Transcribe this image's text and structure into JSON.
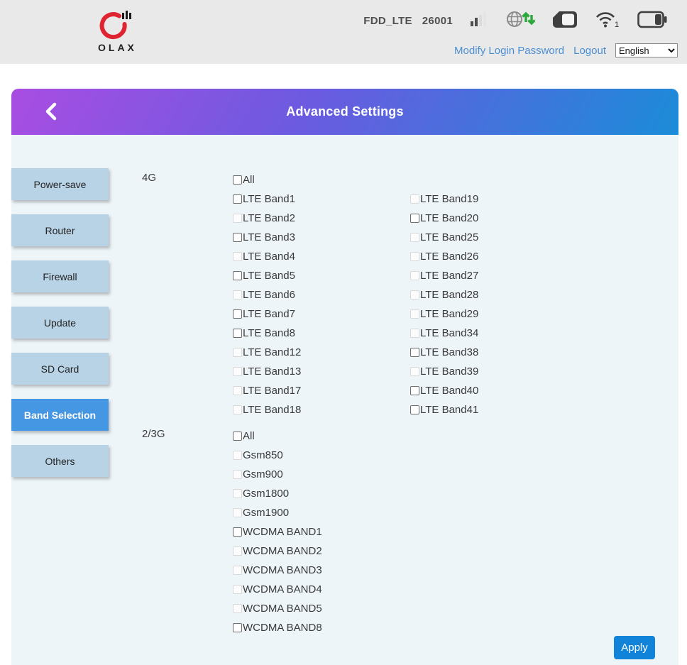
{
  "header": {
    "logo_text": "OLAX",
    "status": {
      "network_type": "FDD_LTE",
      "plmn": "26001",
      "wifi_clients": "1"
    },
    "links": {
      "modify_password": "Modify Login Password",
      "logout": "Logout"
    },
    "language": {
      "selected": "English",
      "options": [
        "English"
      ]
    }
  },
  "titlebar": {
    "title": "Advanced Settings"
  },
  "sidebar": {
    "items": [
      {
        "label": "Power-save",
        "active": false
      },
      {
        "label": "Router",
        "active": false
      },
      {
        "label": "Firewall",
        "active": false
      },
      {
        "label": "Update",
        "active": false
      },
      {
        "label": "SD Card",
        "active": false
      },
      {
        "label": "Band Selection",
        "active": true
      },
      {
        "label": "Others",
        "active": false
      }
    ]
  },
  "band_selection": {
    "section_4g_label": "4G",
    "section_23g_label": "2/3G",
    "bands_4g_col1": [
      {
        "label": "All",
        "enabled": true,
        "checked": false
      },
      {
        "label": "LTE Band1",
        "enabled": true,
        "checked": false
      },
      {
        "label": "LTE Band2",
        "enabled": false,
        "checked": false
      },
      {
        "label": "LTE Band3",
        "enabled": true,
        "checked": false
      },
      {
        "label": "LTE Band4",
        "enabled": false,
        "checked": false
      },
      {
        "label": "LTE Band5",
        "enabled": true,
        "checked": false
      },
      {
        "label": "LTE Band6",
        "enabled": false,
        "checked": false
      },
      {
        "label": "LTE Band7",
        "enabled": true,
        "checked": false
      },
      {
        "label": "LTE Band8",
        "enabled": true,
        "checked": false
      },
      {
        "label": "LTE Band12",
        "enabled": false,
        "checked": false
      },
      {
        "label": "LTE Band13",
        "enabled": false,
        "checked": false
      },
      {
        "label": "LTE Band17",
        "enabled": false,
        "checked": false
      },
      {
        "label": "LTE Band18",
        "enabled": false,
        "checked": false
      }
    ],
    "bands_4g_col2": [
      {
        "label": "LTE Band19",
        "enabled": false,
        "checked": false
      },
      {
        "label": "LTE Band20",
        "enabled": true,
        "checked": false
      },
      {
        "label": "LTE Band25",
        "enabled": false,
        "checked": false
      },
      {
        "label": "LTE Band26",
        "enabled": false,
        "checked": false
      },
      {
        "label": "LTE Band27",
        "enabled": false,
        "checked": false
      },
      {
        "label": "LTE Band28",
        "enabled": false,
        "checked": false
      },
      {
        "label": "LTE Band29",
        "enabled": false,
        "checked": false
      },
      {
        "label": "LTE Band34",
        "enabled": false,
        "checked": false
      },
      {
        "label": "LTE Band38",
        "enabled": true,
        "checked": false
      },
      {
        "label": "LTE Band39",
        "enabled": false,
        "checked": false
      },
      {
        "label": "LTE Band40",
        "enabled": true,
        "checked": false
      },
      {
        "label": "LTE Band41",
        "enabled": true,
        "checked": false
      }
    ],
    "bands_23g": [
      {
        "label": "All",
        "enabled": true,
        "checked": false
      },
      {
        "label": "Gsm850",
        "enabled": false,
        "checked": false
      },
      {
        "label": "Gsm900",
        "enabled": false,
        "checked": false
      },
      {
        "label": "Gsm1800",
        "enabled": false,
        "checked": false
      },
      {
        "label": "Gsm1900",
        "enabled": false,
        "checked": false
      },
      {
        "label": "WCDMA BAND1",
        "enabled": true,
        "checked": false
      },
      {
        "label": "WCDMA BAND2",
        "enabled": false,
        "checked": false
      },
      {
        "label": "WCDMA BAND3",
        "enabled": false,
        "checked": false
      },
      {
        "label": "WCDMA BAND4",
        "enabled": false,
        "checked": false
      },
      {
        "label": "WCDMA BAND5",
        "enabled": false,
        "checked": false
      },
      {
        "label": "WCDMA BAND8",
        "enabled": true,
        "checked": false
      }
    ],
    "apply_label": "Apply"
  },
  "colors": {
    "topbar_bg": "#e9e9e9",
    "link": "#4a8fd2",
    "gradient_start": "#a94de2",
    "gradient_end": "#1b8cd8",
    "content_bg": "#edf5f9",
    "sidebar_item": "#b9d3e6",
    "sidebar_item_active": "#4697e3",
    "apply_button": "#1183d8",
    "logo_red": "#e02330"
  }
}
